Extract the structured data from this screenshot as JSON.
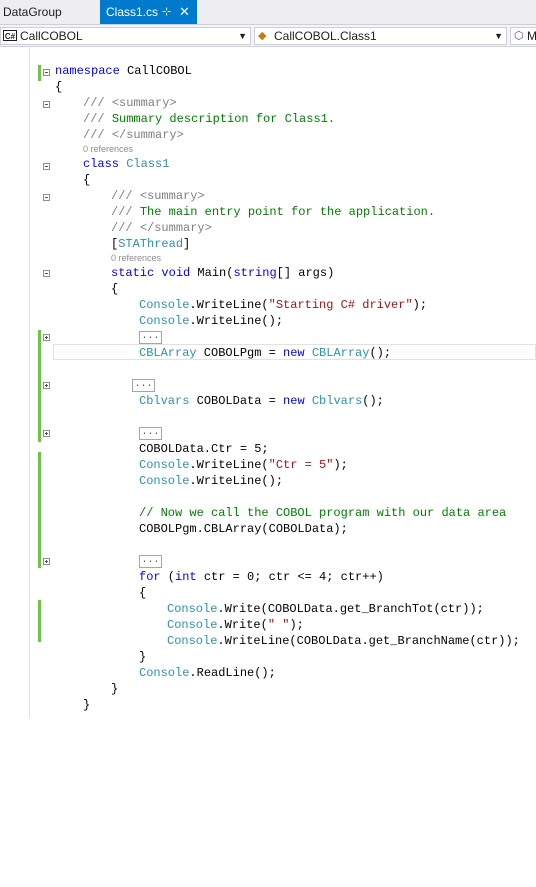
{
  "tabs": [
    {
      "label": "DataGroup"
    },
    {
      "label": "Class1.cs",
      "pin_glyph": "⊹",
      "close_glyph": "✕"
    }
  ],
  "navbar": {
    "project": {
      "badge": "C#",
      "label": "CallCOBOL"
    },
    "type": {
      "label": "CallCOBOL.Class1"
    },
    "member": {
      "label": "M"
    }
  },
  "editor": {
    "code_lens": {
      "zero_references": "0 references"
    },
    "ellipsis": "...",
    "lines": {
      "l01_kw": "namespace",
      "l01_txt": " CallCOBOL",
      "l02": "{",
      "l03_pre": "/// ",
      "l03_tag": "<summary>",
      "l04_pre": "/// ",
      "l04_txt": "Summary description for Class1.",
      "l05_pre": "/// ",
      "l05_tag": "</summary>",
      "l06_kw": "class",
      "l06_sp": " ",
      "l06_ty": "Class1",
      "l07": "{",
      "l08_pre": "/// ",
      "l08_tag": "<summary>",
      "l09_pre": "/// ",
      "l09_txt": "The main entry point for the application.",
      "l10_pre": "/// ",
      "l10_tag": "</summary>",
      "l11_a": "[",
      "l11_ty": "STAThread",
      "l11_b": "]",
      "l12_kw1": "static",
      "l12_sp1": " ",
      "l12_kw2": "void",
      "l12_txt1": " Main(",
      "l12_kw3": "string",
      "l12_txt2": "[] args)",
      "l13": "{",
      "l14_ty": "Console",
      "l14_txt": ".WriteLine(",
      "l14_st": "\"Starting C# driver\"",
      "l14_end": ");",
      "l15_ty": "Console",
      "l15_txt": ".WriteLine();",
      "l17_ty1": "CBLArray",
      "l17_txt1": " COBOLPgm = ",
      "l17_kw": "new",
      "l17_sp": " ",
      "l17_ty2": "CBLArray",
      "l17_txt2": "();",
      "l20_ty1": "Cblvars",
      "l20_txt1": " COBOLData = ",
      "l20_kw": "new",
      "l20_sp": " ",
      "l20_ty2": "Cblvars",
      "l20_txt2": "();",
      "l23": "COBOLData.Ctr = 5;",
      "l24_ty": "Console",
      "l24_txt": ".WriteLine(",
      "l24_st": "\"Ctr = 5\"",
      "l24_end": ");",
      "l25_ty": "Console",
      "l25_txt": ".WriteLine();",
      "l27": "// Now we call the COBOL program with our data area",
      "l28": "COBOLPgm.CBLArray(COBOLData);",
      "l31_kw1": "for",
      "l31_txt1": " (",
      "l31_kw2": "int",
      "l31_txt2": " ctr = 0; ctr <= 4; ctr++)",
      "l32": "{",
      "l33_ty": "Console",
      "l33_txt": ".Write(COBOLData.get_BranchTot(ctr));",
      "l34_ty": "Console",
      "l34_txt": ".Write(",
      "l34_st": "\" \"",
      "l34_end": ");",
      "l35_ty": "Console",
      "l35_txt": ".WriteLine(COBOLData.get_BranchName(ctr));",
      "l36": "}",
      "l37_ty": "Console",
      "l37_txt": ".ReadLine();",
      "l38": "}",
      "l39": "}"
    }
  },
  "colors": {
    "keyword": "#0000ff",
    "type": "#2b91af",
    "comment": "#008000",
    "xmldoc": "#808080",
    "string": "#a31515",
    "active_tab": "#007acc",
    "changed_line_marker": "#6cc644"
  }
}
